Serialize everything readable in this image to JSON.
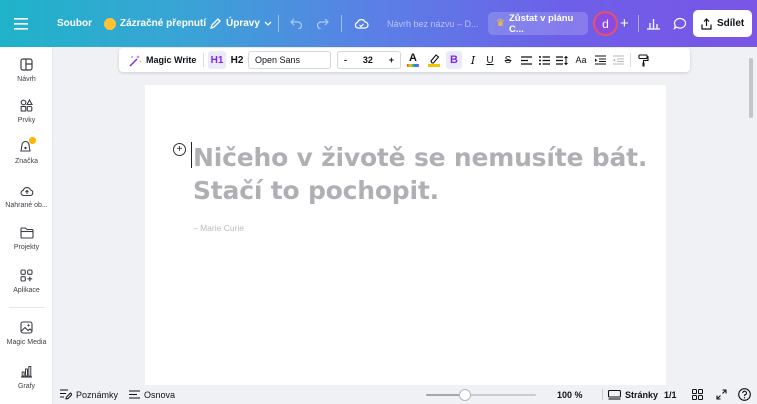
{
  "topbar": {
    "menu_label": "Soubor",
    "magic_switch_label": "Zázračné přepnutí",
    "edit_label": "Úpravy",
    "doc_title": "Návrh bez názvu – D...",
    "upgrade_label": "Zůstat v plánu C...",
    "avatar_letter": "d",
    "share_label": "Sdílet"
  },
  "sidebar": {
    "items": [
      {
        "label": "Návrh",
        "icon": "layout-icon"
      },
      {
        "label": "Prvky",
        "icon": "elements-icon"
      },
      {
        "label": "Značka",
        "icon": "brand-icon"
      },
      {
        "label": "Nahrané ob...",
        "icon": "upload-icon"
      },
      {
        "label": "Projekty",
        "icon": "folder-icon"
      },
      {
        "label": "Aplikace",
        "icon": "apps-icon"
      },
      {
        "label": "Magic Media",
        "icon": "magic-media-icon"
      },
      {
        "label": "Grafy",
        "icon": "charts-icon"
      }
    ]
  },
  "format_toolbar": {
    "magic_write_label": "Magic Write",
    "h1_label": "H1",
    "h2_label": "H2",
    "font_name": "Open Sans",
    "font_size": "32",
    "minus": "-",
    "plus": "+",
    "bold": "B",
    "italic": "I",
    "underline": "U",
    "strike": "S",
    "case": "Aa"
  },
  "canvas": {
    "heading_line1": "Ničeho v životě se nemusíte bát.",
    "heading_line2": "Stačí to pochopit.",
    "author": "– Marie Curie",
    "add_symbol": "+"
  },
  "bottombar": {
    "notes_label": "Poznámky",
    "outline_label": "Osnova",
    "zoom": "100 %",
    "zoom_fraction": 0.35,
    "pages_label": "Stránky",
    "page_count": "1/1"
  },
  "colors": {
    "accent": "#7d2ae8",
    "text_color_bar": "#ff3b30",
    "highlight_bar": "#f5c400",
    "heading_text": "#aeb0b4"
  }
}
